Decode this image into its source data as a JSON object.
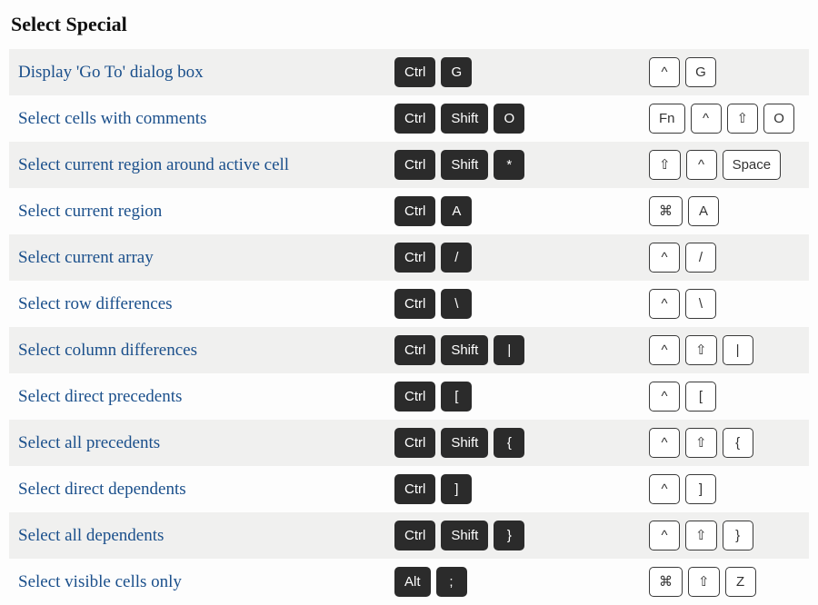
{
  "title": "Select Special",
  "rows": [
    {
      "desc": "Display 'Go To' dialog box",
      "win": [
        "Ctrl",
        "G"
      ],
      "mac": [
        "^",
        "G"
      ]
    },
    {
      "desc": "Select cells with comments",
      "win": [
        "Ctrl",
        "Shift",
        "O"
      ],
      "mac": [
        "Fn",
        "^",
        "⇧",
        "O"
      ]
    },
    {
      "desc": "Select current region around active cell",
      "win": [
        "Ctrl",
        "Shift",
        "*"
      ],
      "mac": [
        "⇧",
        "^",
        "Space"
      ]
    },
    {
      "desc": "Select current region",
      "win": [
        "Ctrl",
        "A"
      ],
      "mac": [
        "⌘",
        "A"
      ]
    },
    {
      "desc": "Select current array",
      "win": [
        "Ctrl",
        "/"
      ],
      "mac": [
        "^",
        "/"
      ]
    },
    {
      "desc": "Select row differences",
      "win": [
        "Ctrl",
        "\\"
      ],
      "mac": [
        "^",
        "\\"
      ]
    },
    {
      "desc": "Select column differences",
      "win": [
        "Ctrl",
        "Shift",
        "|"
      ],
      "mac": [
        "^",
        "⇧",
        "|"
      ]
    },
    {
      "desc": "Select direct precedents",
      "win": [
        "Ctrl",
        "["
      ],
      "mac": [
        "^",
        "["
      ]
    },
    {
      "desc": "Select all precedents",
      "win": [
        "Ctrl",
        "Shift",
        "{"
      ],
      "mac": [
        "^",
        "⇧",
        "{"
      ]
    },
    {
      "desc": "Select direct dependents",
      "win": [
        "Ctrl",
        "]"
      ],
      "mac": [
        "^",
        "]"
      ]
    },
    {
      "desc": "Select all dependents",
      "win": [
        "Ctrl",
        "Shift",
        "}"
      ],
      "mac": [
        "^",
        "⇧",
        "}"
      ]
    },
    {
      "desc": "Select visible cells only",
      "win": [
        "Alt",
        ";"
      ],
      "mac": [
        "⌘",
        "⇧",
        "Z"
      ]
    }
  ]
}
